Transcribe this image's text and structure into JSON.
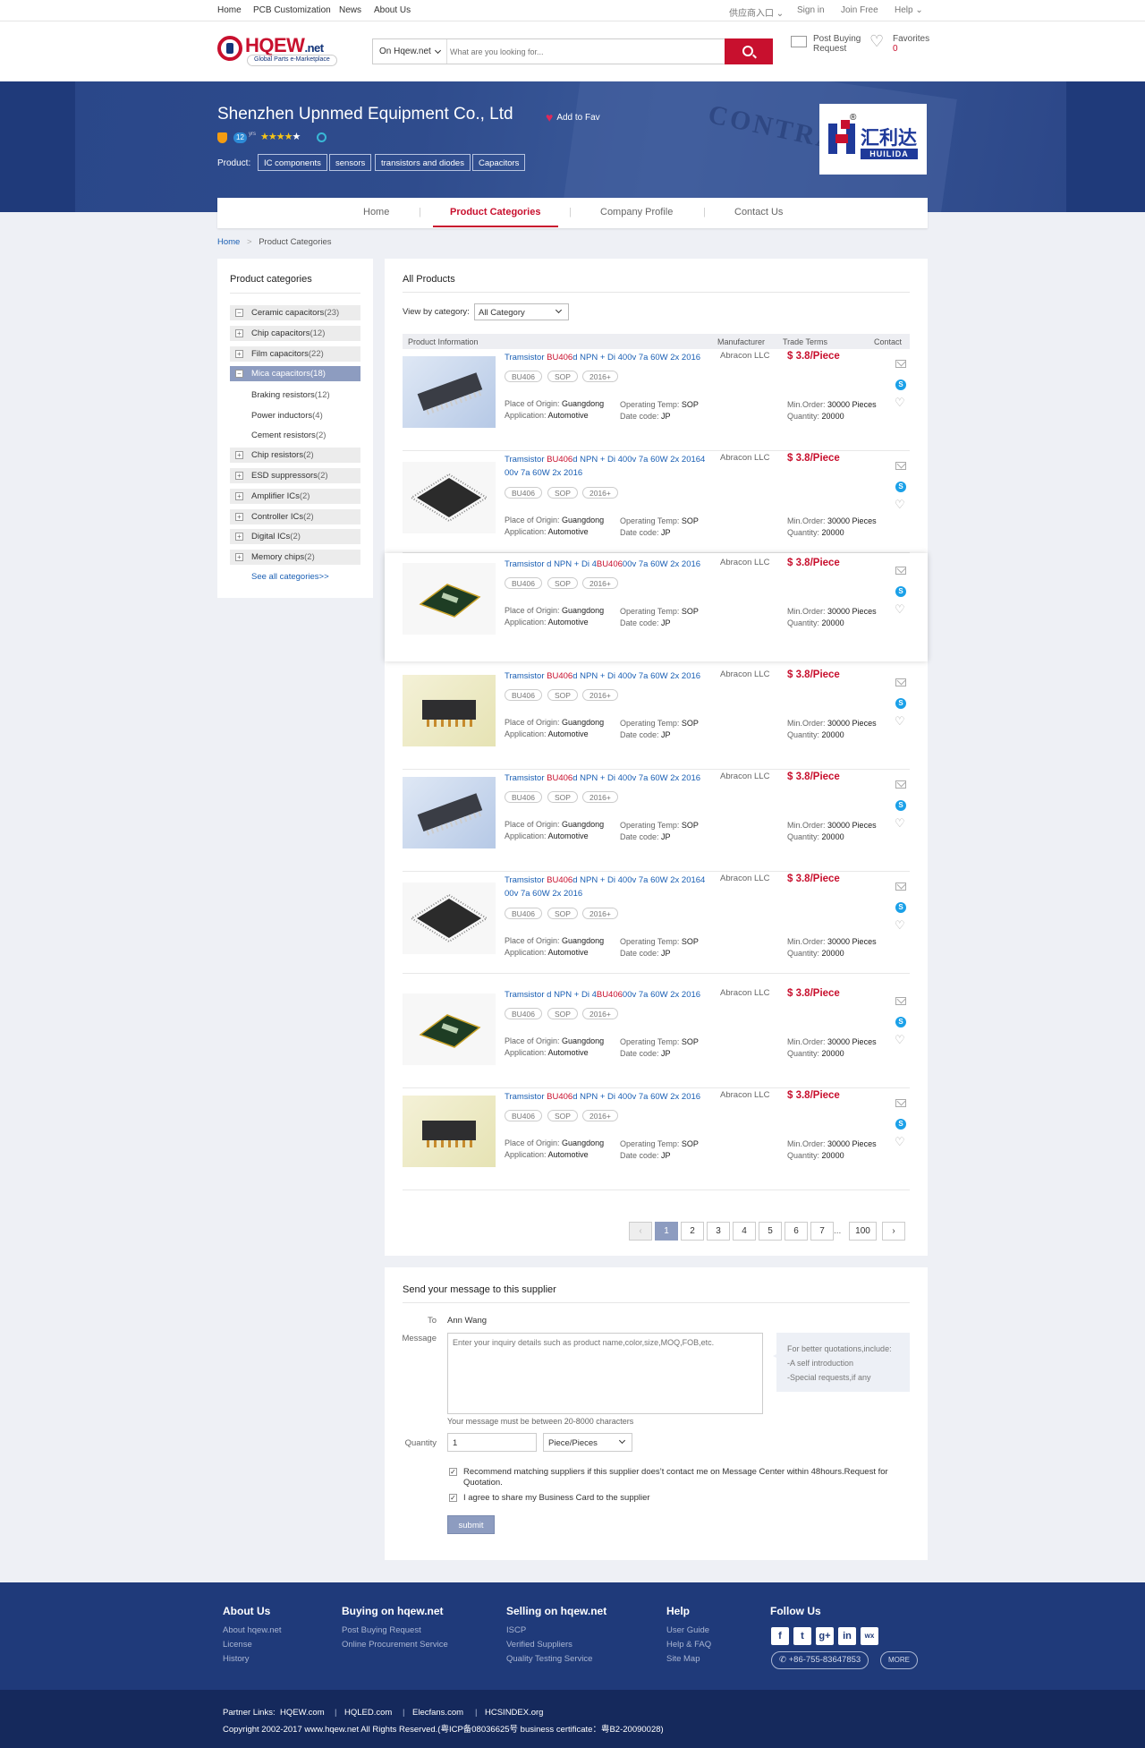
{
  "topbar": {
    "links": [
      "Home",
      "PCB Customization",
      "News",
      "About Us"
    ],
    "supplier_entry": "供应商入口",
    "sign_in": "Sign in",
    "join": "Join Free",
    "help": "Help"
  },
  "header": {
    "logo_text": "HQEW",
    "logo_suffix": ".net",
    "logo_tagline": "Global Parts e-Marketplace",
    "search_scope": "On Hqew.net",
    "search_placeholder": "What are you looking for...",
    "post_buying": "Post Buying Request",
    "favorites_label": "Favorites",
    "favorites_count": "0"
  },
  "banner": {
    "company": "Shenzhen Upnmed Equipment Co., Ltd",
    "add_to_fav": "Add to Fav",
    "years": "12",
    "years_unit": "yrs",
    "stars": 5,
    "product_label": "Product:",
    "product_tags": [
      "IC components",
      "sensors",
      "transistors and diodes",
      "Capacitors"
    ],
    "bg_word": "CONTRACT",
    "seller_logo_text": "汇利达",
    "seller_logo_en": "HUILIDA",
    "seller_logo_mark": "®"
  },
  "nav": {
    "tabs": [
      "Home",
      "Product Categories",
      "Company Profile",
      "Contact Us"
    ],
    "active": "Product Categories"
  },
  "breadcrumb": {
    "home": "Home",
    "current": "Product Categories"
  },
  "sidebar": {
    "title": "Product categories",
    "categories": [
      {
        "name": "Ceramic capacitors",
        "count": "(23)",
        "box": "−"
      },
      {
        "name": "Chip capacitors",
        "count": "(12)",
        "box": "+"
      },
      {
        "name": "Film capacitors",
        "count": "(22)",
        "box": "+"
      },
      {
        "name": "Mica capacitors",
        "count": "(18)",
        "box": "−"
      },
      {
        "name": "Chip resistors",
        "count": "(2)",
        "box": "+"
      },
      {
        "name": "ESD suppressors",
        "count": "(2)",
        "box": "+"
      },
      {
        "name": "Amplifier ICs",
        "count": "(2)",
        "box": "+"
      },
      {
        "name": "Controller ICs",
        "count": "(2)",
        "box": "+"
      },
      {
        "name": "Digital ICs",
        "count": "(2)",
        "box": "+"
      },
      {
        "name": "Memory chips",
        "count": "(2)",
        "box": "+"
      }
    ],
    "subcategories": [
      {
        "name": "Braking resistors",
        "count": "(12)"
      },
      {
        "name": "Power inductors",
        "count": "(4)"
      },
      {
        "name": "Cement resistors",
        "count": "(2)"
      }
    ],
    "see_all": "See all categories>>"
  },
  "products": {
    "title": "All Products",
    "view_by": "View by category:",
    "category_select": "All Category",
    "columns": [
      "Product Information",
      "Manufacturer",
      "Trade Terms",
      "Contact"
    ],
    "labels": {
      "origin": "Place of Origin:",
      "application": "Application:",
      "temp": "Operating Temp:",
      "date": "Date code:",
      "min_order": "Min.Order:",
      "quantity": "Quantity:"
    },
    "items": [
      {
        "pre": "Tramsistor ",
        "hl": "BU406",
        "post": "d NPN + Di 400v 7a 60W 2x 2016",
        "tags": [
          "BU406",
          "SOP",
          "2016+"
        ],
        "origin": "Guangdong",
        "application": "Automotive",
        "temp": "SOP",
        "date": "JP",
        "mfr": "Abracon LLC",
        "price": "$ 3.8/Piece",
        "min_order": "30000 Pieces",
        "quantity": "20000",
        "img": "blue"
      },
      {
        "pre": "Tramsistor ",
        "hl": "BU406",
        "post": "d NPN + Di 400v 7a 60W 2x 20164 00v 7a 60W 2x 2016",
        "tags": [
          "BU406",
          "SOP",
          "2016+"
        ],
        "origin": "Guangdong",
        "application": "Automotive",
        "temp": "SOP",
        "date": "JP",
        "mfr": "Abracon LLC",
        "price": "$ 3.8/Piece",
        "min_order": "30000 Pieces",
        "quantity": "20000",
        "img": "white"
      },
      {
        "pre": "Tramsistor d NPN + Di 4",
        "hl": "BU406",
        "post": "00v 7a 60W 2x 2016",
        "tags": [
          "BU406",
          "SOP",
          "2016+"
        ],
        "origin": "Guangdong",
        "application": "Automotive",
        "temp": "SOP",
        "date": "JP",
        "mfr": "Abracon LLC",
        "price": "$ 3.8/Piece",
        "min_order": "30000 Pieces",
        "quantity": "20000",
        "img": "green"
      },
      {
        "pre": "Tramsistor ",
        "hl": "BU406",
        "post": "d NPN + Di 400v 7a 60W 2x 2016",
        "tags": [
          "BU406",
          "SOP",
          "2016+"
        ],
        "origin": "Guangdong",
        "application": "Automotive",
        "temp": "SOP",
        "date": "JP",
        "mfr": "Abracon LLC",
        "price": "$ 3.8/Piece",
        "min_order": "30000 Pieces",
        "quantity": "20000",
        "img": "cream"
      },
      {
        "pre": "Tramsistor ",
        "hl": "BU406",
        "post": "d NPN + Di 400v 7a 60W 2x 2016",
        "tags": [
          "BU406",
          "SOP",
          "2016+"
        ],
        "origin": "Guangdong",
        "application": "Automotive",
        "temp": "SOP",
        "date": "JP",
        "mfr": "Abracon LLC",
        "price": "$ 3.8/Piece",
        "min_order": "30000 Pieces",
        "quantity": "20000",
        "img": "blue"
      },
      {
        "pre": "Tramsistor ",
        "hl": "BU406",
        "post": "d NPN + Di 400v 7a 60W 2x 20164 00v 7a 60W 2x 2016",
        "tags": [
          "BU406",
          "SOP",
          "2016+"
        ],
        "origin": "Guangdong",
        "application": "Automotive",
        "temp": "SOP",
        "date": "JP",
        "mfr": "Abracon LLC",
        "price": "$ 3.8/Piece",
        "min_order": "30000 Pieces",
        "quantity": "20000",
        "img": "white"
      },
      {
        "pre": "Tramsistor d NPN + Di 4",
        "hl": "BU406",
        "post": "00v 7a 60W 2x 2016",
        "tags": [
          "BU406",
          "SOP",
          "2016+"
        ],
        "origin": "Guangdong",
        "application": "Automotive",
        "temp": "SOP",
        "date": "JP",
        "mfr": "Abracon LLC",
        "price": "$ 3.8/Piece",
        "min_order": "30000 Pieces",
        "quantity": "20000",
        "img": "green"
      },
      {
        "pre": "Tramsistor ",
        "hl": "BU406",
        "post": "d NPN + Di 400v 7a 60W 2x 2016",
        "tags": [
          "BU406",
          "SOP",
          "2016+"
        ],
        "origin": "Guangdong",
        "application": "Automotive",
        "temp": "SOP",
        "date": "JP",
        "mfr": "Abracon LLC",
        "price": "$ 3.8/Piece",
        "min_order": "30000 Pieces",
        "quantity": "20000",
        "img": "cream"
      }
    ],
    "pagination": [
      "‹",
      "1",
      "2",
      "3",
      "4",
      "5",
      "6",
      "7",
      "...",
      "100",
      "›"
    ],
    "current_page": "1"
  },
  "message": {
    "title": "Send your message to this supplier",
    "to_label": "To",
    "to_value": "Ann Wang",
    "message_label": "Message",
    "placeholder": "Enter your inquiry details such as product name,color,size,MOQ,FOB,etc.",
    "tip_lines": [
      "For better quotations,include:",
      "-A self introduction",
      "-Special requests,if any"
    ],
    "length_note": "Your message must be between 20-8000 characters",
    "quantity_label": "Quantity",
    "quantity_value": "1",
    "unit": "Piece/Pieces",
    "check1": "Recommend matching suppliers if this supplier does’t contact me on Message Center within 48hours.Request for Quotation.",
    "check2": "I agree to share my Business Card to the supplier",
    "submit": "submit"
  },
  "footer": {
    "about": {
      "title": "About Us",
      "links": [
        "About hqew.net",
        "License",
        "History"
      ]
    },
    "buying": {
      "title": "Buying on hqew.net",
      "links": [
        "Post Buying Request",
        "Online Procurement Service"
      ]
    },
    "selling": {
      "title": "Selling on hqew.net",
      "links": [
        "ISCP",
        "Verified Suppliers",
        "Quality Testing Service"
      ]
    },
    "help": {
      "title": "Help",
      "links": [
        "User  Guide",
        "Help & FAQ",
        "Site Map"
      ]
    },
    "follow": {
      "title": "Follow Us",
      "social": [
        "f",
        "t",
        "g+",
        "in",
        "wx"
      ],
      "phone": "+86-755-83647853",
      "more": "MORE"
    },
    "partner_label": "Partner Links:",
    "partners": [
      "HQEW.com",
      "HQLED.com",
      "Elecfans.com",
      "HCSINDEX.org"
    ],
    "copyright": "Copyright 2002-2017 www.hqew.net All Rights Reserved.(粤ICP备08036625号 business certificate：粤B2-20090028)"
  },
  "colors": {
    "brand_red": "#c8102e",
    "brand_navy": "#1f3a7a",
    "link_blue": "#1a5fb4",
    "active_gray_blue": "#8d9cc0"
  }
}
